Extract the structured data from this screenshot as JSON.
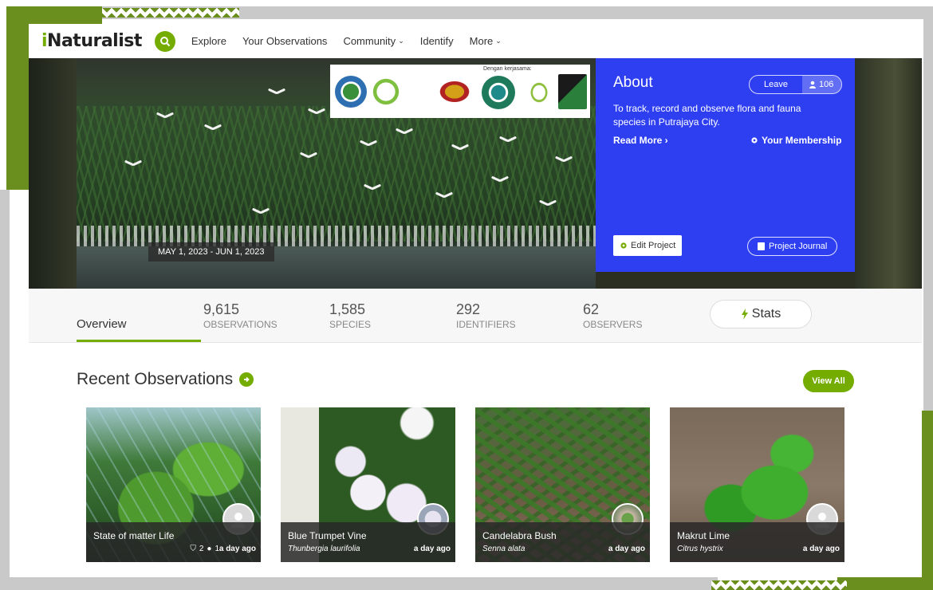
{
  "navbar": {
    "logo_prefix": "i",
    "logo_rest": "Naturalist",
    "items": [
      {
        "label": "Explore"
      },
      {
        "label": "Your Observations"
      },
      {
        "label": "Community"
      },
      {
        "label": "Identify"
      },
      {
        "label": "More"
      }
    ]
  },
  "hero": {
    "date_range": "MAY 1, 2023 - JUN 1, 2023",
    "sponsor_text": "Dengan kerjasama:"
  },
  "about": {
    "title": "About",
    "leave_label": "Leave",
    "member_count": "106",
    "description": "To track, record and observe flora and fauna species in Putrajaya City.",
    "read_more": "Read More ›",
    "membership": "Your Membership",
    "edit_project": "Edit Project",
    "project_journal": "Project Journal"
  },
  "stats": {
    "overview_tab": "Overview",
    "items": [
      {
        "value": "9,615",
        "label": "OBSERVATIONS"
      },
      {
        "value": "1,585",
        "label": "SPECIES"
      },
      {
        "value": "292",
        "label": "IDENTIFIERS"
      },
      {
        "value": "62",
        "label": "OBSERVERS"
      }
    ],
    "stats_button": "Stats"
  },
  "recent": {
    "title": "Recent Observations",
    "view_all": "View All",
    "cards": [
      {
        "name": "State of matter Life",
        "scientific": "",
        "ids": "2",
        "comments": "1",
        "time": "a day ago"
      },
      {
        "name": "Blue Trumpet Vine",
        "scientific": "Thunbergia laurifolia",
        "time": "a day ago"
      },
      {
        "name": "Candelabra Bush",
        "scientific": "Senna alata",
        "time": "a day ago"
      },
      {
        "name": "Makrut Lime",
        "scientific": "Citrus hystrix",
        "time": "a day ago"
      }
    ]
  },
  "colors": {
    "brand_green": "#74ac00",
    "about_blue": "#2e3ff2",
    "frame_green": "#6b8f1f"
  }
}
